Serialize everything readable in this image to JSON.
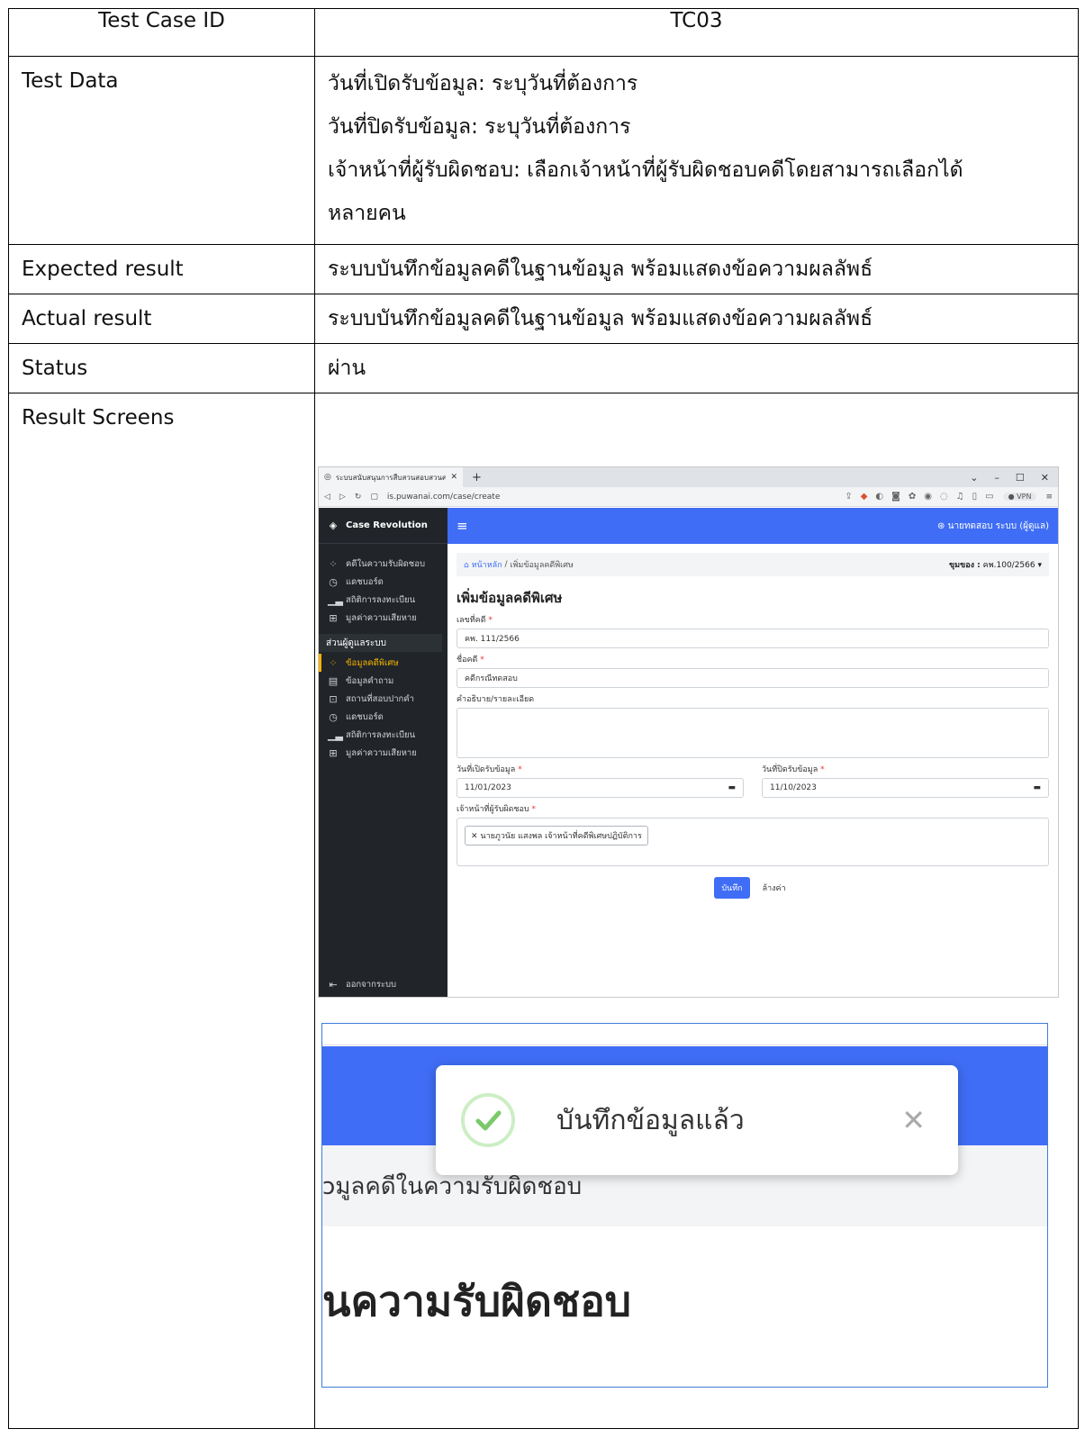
{
  "table": {
    "header": {
      "label": "Test Case ID",
      "value": "TC03"
    },
    "rows": [
      {
        "label": "Test Data",
        "lines": [
          "วันที่เปิดรับข้อมูล: ระบุวันที่ต้องการ",
          "วันที่ปิดรับข้อมูล: ระบุวันที่ต้องการ",
          "เจ้าหน้าที่ผู้รับผิดชอบ: เลือกเจ้าหน้าที่ผู้รับผิดชอบคดีโดยสามารถเลือกได้",
          "หลายคน"
        ]
      },
      {
        "label": "Expected result",
        "value": "ระบบบันทึกข้อมูลคดีในฐานข้อมูล พร้อมแสดงข้อความผลลัพธ์"
      },
      {
        "label": "Actual result",
        "value": "ระบบบันทึกข้อมูลคดีในฐานข้อมูล พร้อมแสดงข้อความผลลัพธ์"
      },
      {
        "label": "Status",
        "value": "ผ่าน"
      },
      {
        "label": "Result Screens"
      }
    ]
  },
  "screenshot1": {
    "tab_title": "ระบบสนับสนุนการสืบสวนสอบสวนคดีพิเศษ",
    "url": "is.puwanai.com/case/create",
    "vpn": "VPN",
    "brand": "Case Revolution",
    "menu": [
      "คดีในความรับผิดชอบ",
      "แดชบอร์ด",
      "สถิติการลงทะเบียน",
      "มูลค่าความเสียหาย"
    ],
    "admin_section": "ส่วนผู้ดูแลระบบ",
    "admin_menu": [
      "ข้อมูลคดีพิเศษ",
      "ข้อมูลคำถาม",
      "สถานที่สอบปากคำ",
      "แดชบอร์ด",
      "สถิติการลงทะเบียน",
      "มูลค่าความเสียหาย"
    ],
    "logout": "ออกจากระบบ",
    "user": "นายทดสอบ ระบบ (ผู้ดูแล)",
    "breadcrumb_home": "หน้าหลัก",
    "breadcrumb_current": "เพิ่มข้อมูลคดีพิเศษ",
    "term_label": "ขุมของ :",
    "term_value": "คพ.100/2566",
    "form_title": "เพิ่มข้อมูลคดีพิเศษ",
    "case_no_label": "เลขที่คดี",
    "case_no_value": "คพ. 111/2566",
    "case_name_label": "ชื่อคดี",
    "case_name_value": "คดีกรณีทดสอบ",
    "desc_label": "คำอธิบาย/รายละเอียด",
    "open_date_label": "วันที่เปิดรับข้อมูล",
    "open_date_value": "11/01/2023",
    "close_date_label": "วันที่ปิดรับข้อมูล",
    "close_date_value": "11/10/2023",
    "officer_label": "เจ้าหน้าที่ผู้รับผิดชอบ",
    "officer_tag": "นายภูวนัย แสงพล เจ้าหน้าที่คดีพิเศษปฏิบัติการ",
    "save_label": "บันทึก",
    "clear_label": "ล้างค่า"
  },
  "screenshot2": {
    "toast_message": "บันทึกข้อมูลแล้ว",
    "crumb_text": "ɔมูลคดีในความรับผิดชอบ",
    "heading_text": "นความรับผิดชอบ"
  }
}
